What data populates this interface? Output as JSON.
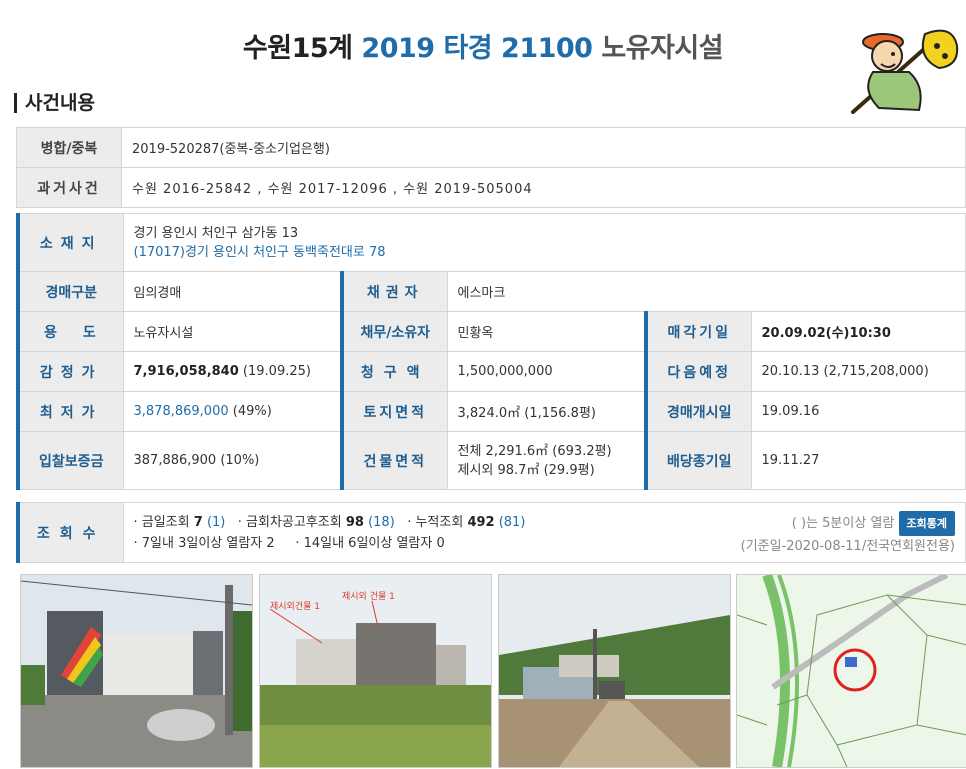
{
  "header": {
    "court": "수원15계",
    "case_no": "2019 타경 21100",
    "category": "노유자시설"
  },
  "section": {
    "title": "사건내용"
  },
  "merge": {
    "label": "병합/중복",
    "value": "2019-520287(중복-중소기업은행)"
  },
  "past_cases": {
    "label": "과거사건",
    "value": "수원 2016-25842 , 수원 2017-12096 , 수원 2019-505004"
  },
  "location": {
    "label": "소재지",
    "address": "경기 용인시 처인구 삼가동 13",
    "road_address": "(17017)경기 용인시 처인구 동백죽전대로 78"
  },
  "auction_type": {
    "label": "경매구분",
    "value": "임의경매"
  },
  "creditor": {
    "label": "채권자",
    "value": "에스마크"
  },
  "use": {
    "label": "용도",
    "value": "노유자시설"
  },
  "debtor": {
    "label": "채무/소유자",
    "value": "민황옥"
  },
  "sale_date": {
    "label": "매각기일",
    "value": "20.09.02(수)10:30"
  },
  "appraisal": {
    "label": "감정가",
    "value": "7,916,058,840",
    "date": "(19.09.25)"
  },
  "claim": {
    "label": "청구액",
    "value": "1,500,000,000"
  },
  "next_date": {
    "label": "다음예정",
    "value": "20.10.13 (2,715,208,000)"
  },
  "minimum": {
    "label": "최저가",
    "value": "3,878,869,000",
    "pct": "(49%)"
  },
  "land_area": {
    "label": "토지면적",
    "value": "3,824.0㎡ (1,156.8평)"
  },
  "start_date": {
    "label": "경매개시일",
    "value": "19.09.16"
  },
  "deposit": {
    "label": "입찰보증금",
    "value": "387,886,900 (10%)"
  },
  "building_area": {
    "label": "건물면적",
    "line1": "전체 2,291.6㎡ (693.2평)",
    "line2": "제시외 98.7㎡ (29.9평)"
  },
  "dividend_date": {
    "label": "배당종기일",
    "value": "19.11.27"
  },
  "views": {
    "label": "조회수",
    "today_label": "· 금일조회",
    "today": "7",
    "today_sub": "(1)",
    "after_label": "· 금회차공고후조회",
    "after": "98",
    "after_sub": "(18)",
    "total_label": "· 누적조회",
    "total": "492",
    "total_sub": "(81)",
    "line2_a": "· 7일내 3일이상 열람자 2",
    "line2_b": "· 14일내 6일이상 열람자 0",
    "note": "( )는 5분이상 열람",
    "button": "조회통계",
    "basis": "(기준일-2020-08-11/전국연회원전용)"
  },
  "photo_labels": {
    "label_a": "제시외건물 1",
    "label_b": "제시외 건물 1"
  }
}
